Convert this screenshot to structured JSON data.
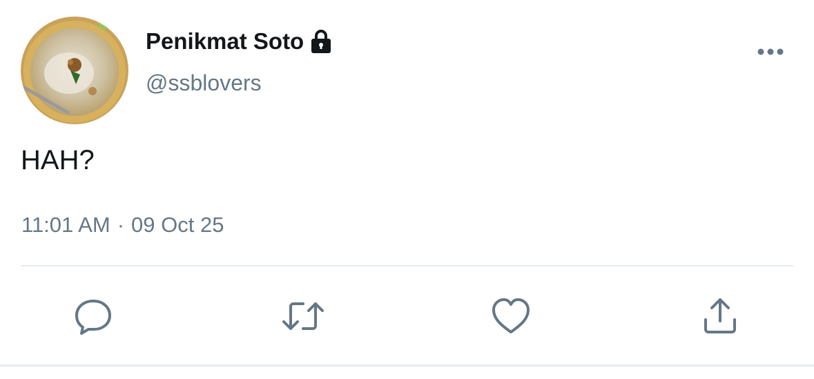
{
  "tweet": {
    "author": {
      "display_name": "Penikmat Soto",
      "handle": "@ssblovers",
      "avatar_icon": "soto-bowl-avatar",
      "protected_icon": "lock-icon"
    },
    "more_icon": "more-options-icon",
    "text": "HAH?",
    "time": "11:01 AM",
    "separator": "·",
    "date": "09 Oct 25"
  },
  "actions": [
    {
      "name": "reply",
      "icon": "reply-icon"
    },
    {
      "name": "retweet",
      "icon": "retweet-icon"
    },
    {
      "name": "like",
      "icon": "heart-icon"
    },
    {
      "name": "share",
      "icon": "share-icon"
    }
  ],
  "colors": {
    "text_primary": "#14171a",
    "text_secondary": "#657786",
    "icon": "#657786",
    "divider": "#e6ecf0"
  }
}
